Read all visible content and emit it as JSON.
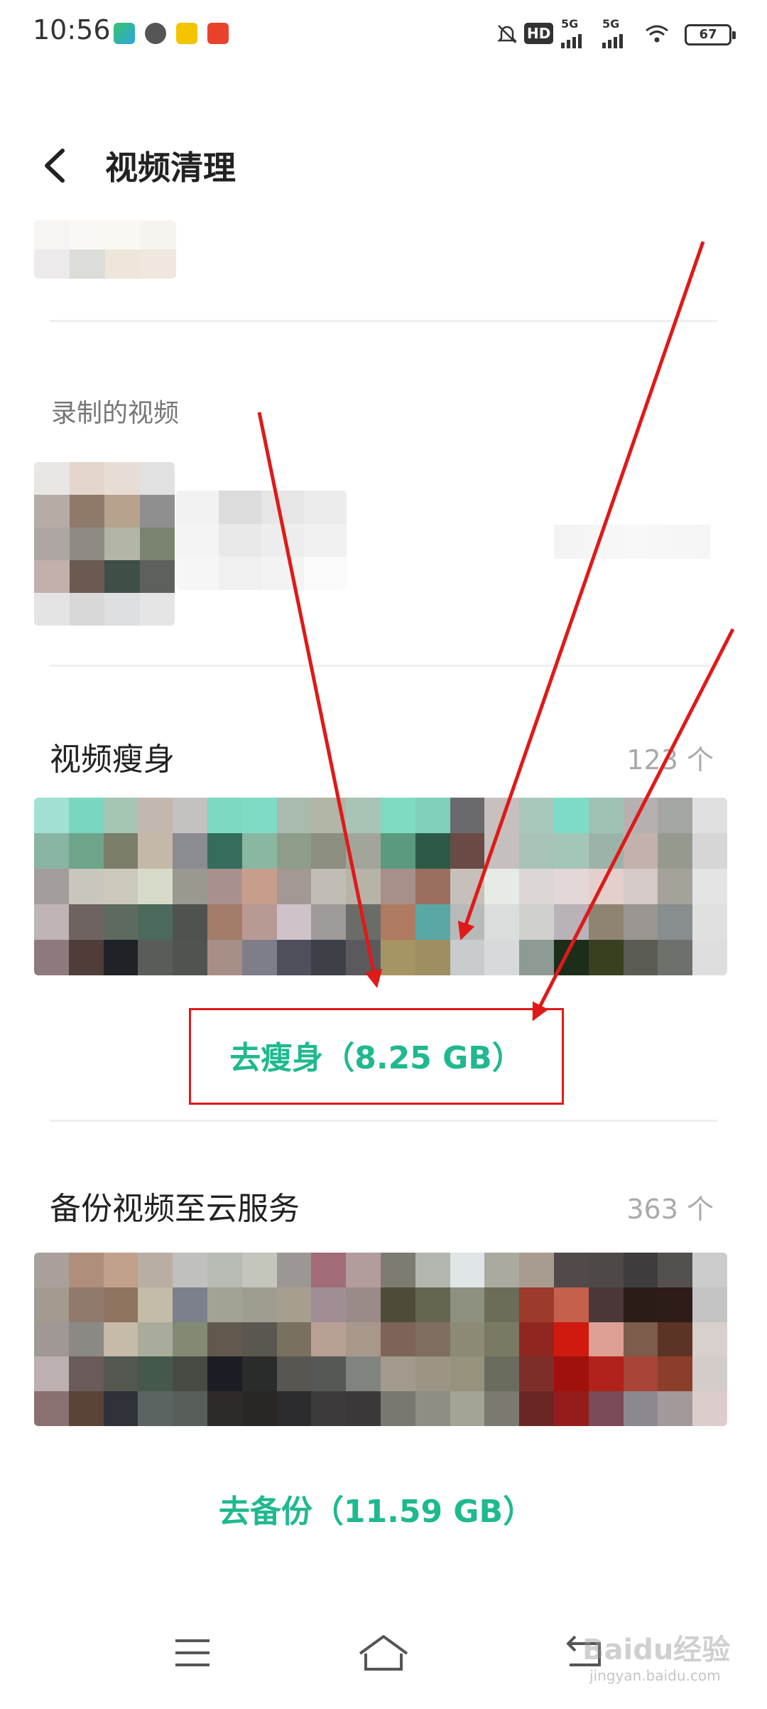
{
  "status_bar": {
    "time": "10:56",
    "battery": "67",
    "hd_badge": "HD",
    "net1": "5G",
    "net2": "5G"
  },
  "header": {
    "title": "视频清理"
  },
  "recorded": {
    "label": "录制的视频"
  },
  "slim": {
    "title": "视频瘦身",
    "count": "123 个",
    "action": "去瘦身（8.25 GB）"
  },
  "backup": {
    "title": "备份视频至云服务",
    "count": "363 个",
    "action": "去备份（11.59 GB）"
  },
  "watermark": {
    "text": "Baidu经验",
    "sub": "jingyan.baidu.com"
  },
  "colors": {
    "accent": "#1fb98f",
    "annotation_red": "#e01919"
  },
  "icons": [
    "back-arrow-icon",
    "menu-icon",
    "home-icon",
    "back-nav-icon",
    "wifi-icon",
    "mute-icon"
  ]
}
